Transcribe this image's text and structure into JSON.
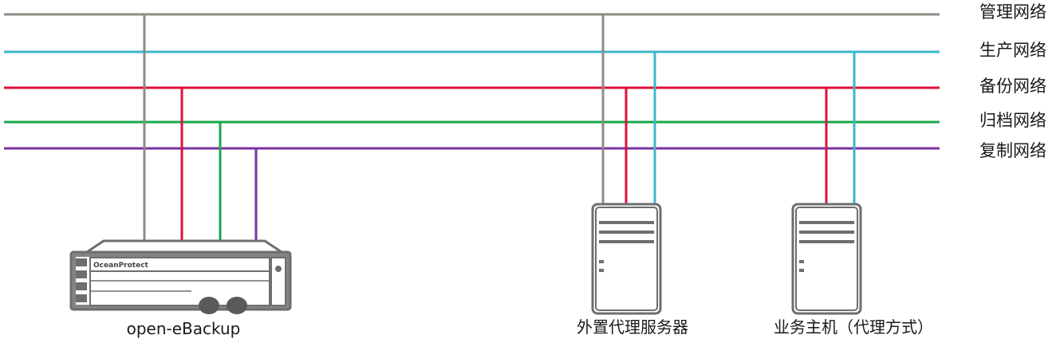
{
  "networks": [
    {
      "label": "管理网络",
      "color": "#8c8c84"
    },
    {
      "label": "生产网络",
      "color": "#3cb7c9"
    },
    {
      "label": "备份网络",
      "color": "#e0103a"
    },
    {
      "label": "归档网络",
      "color": "#17a84a"
    },
    {
      "label": "复制网络",
      "color": "#7a32a0"
    }
  ],
  "devices": {
    "appliance": {
      "label": "open-eBackup",
      "brand": "OceanProtect"
    },
    "proxy_server": {
      "label": "外置代理服务器"
    },
    "host": {
      "label": "业务主机（代理方式）"
    }
  }
}
